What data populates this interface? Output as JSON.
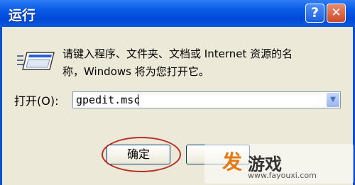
{
  "window": {
    "title": "运行",
    "help_label": "?",
    "close_label": "✕"
  },
  "dialog": {
    "description": "请键入程序、文件夹、文档或 Internet 资源的名\n称，Windows 将为您打开它。",
    "open_label": "打开(O):",
    "open_value": "gpedit.msc",
    "icon": "run-program-icon"
  },
  "buttons": {
    "ok": "确定",
    "cancel": ""
  },
  "watermark": {
    "logo_char": "发",
    "name": "游戏",
    "url": "www.fayouxi.com"
  },
  "colors": {
    "titlebar": "#0a5ce6",
    "highlight_circle": "#b7312b",
    "watermark_accent": "#e37a13"
  }
}
